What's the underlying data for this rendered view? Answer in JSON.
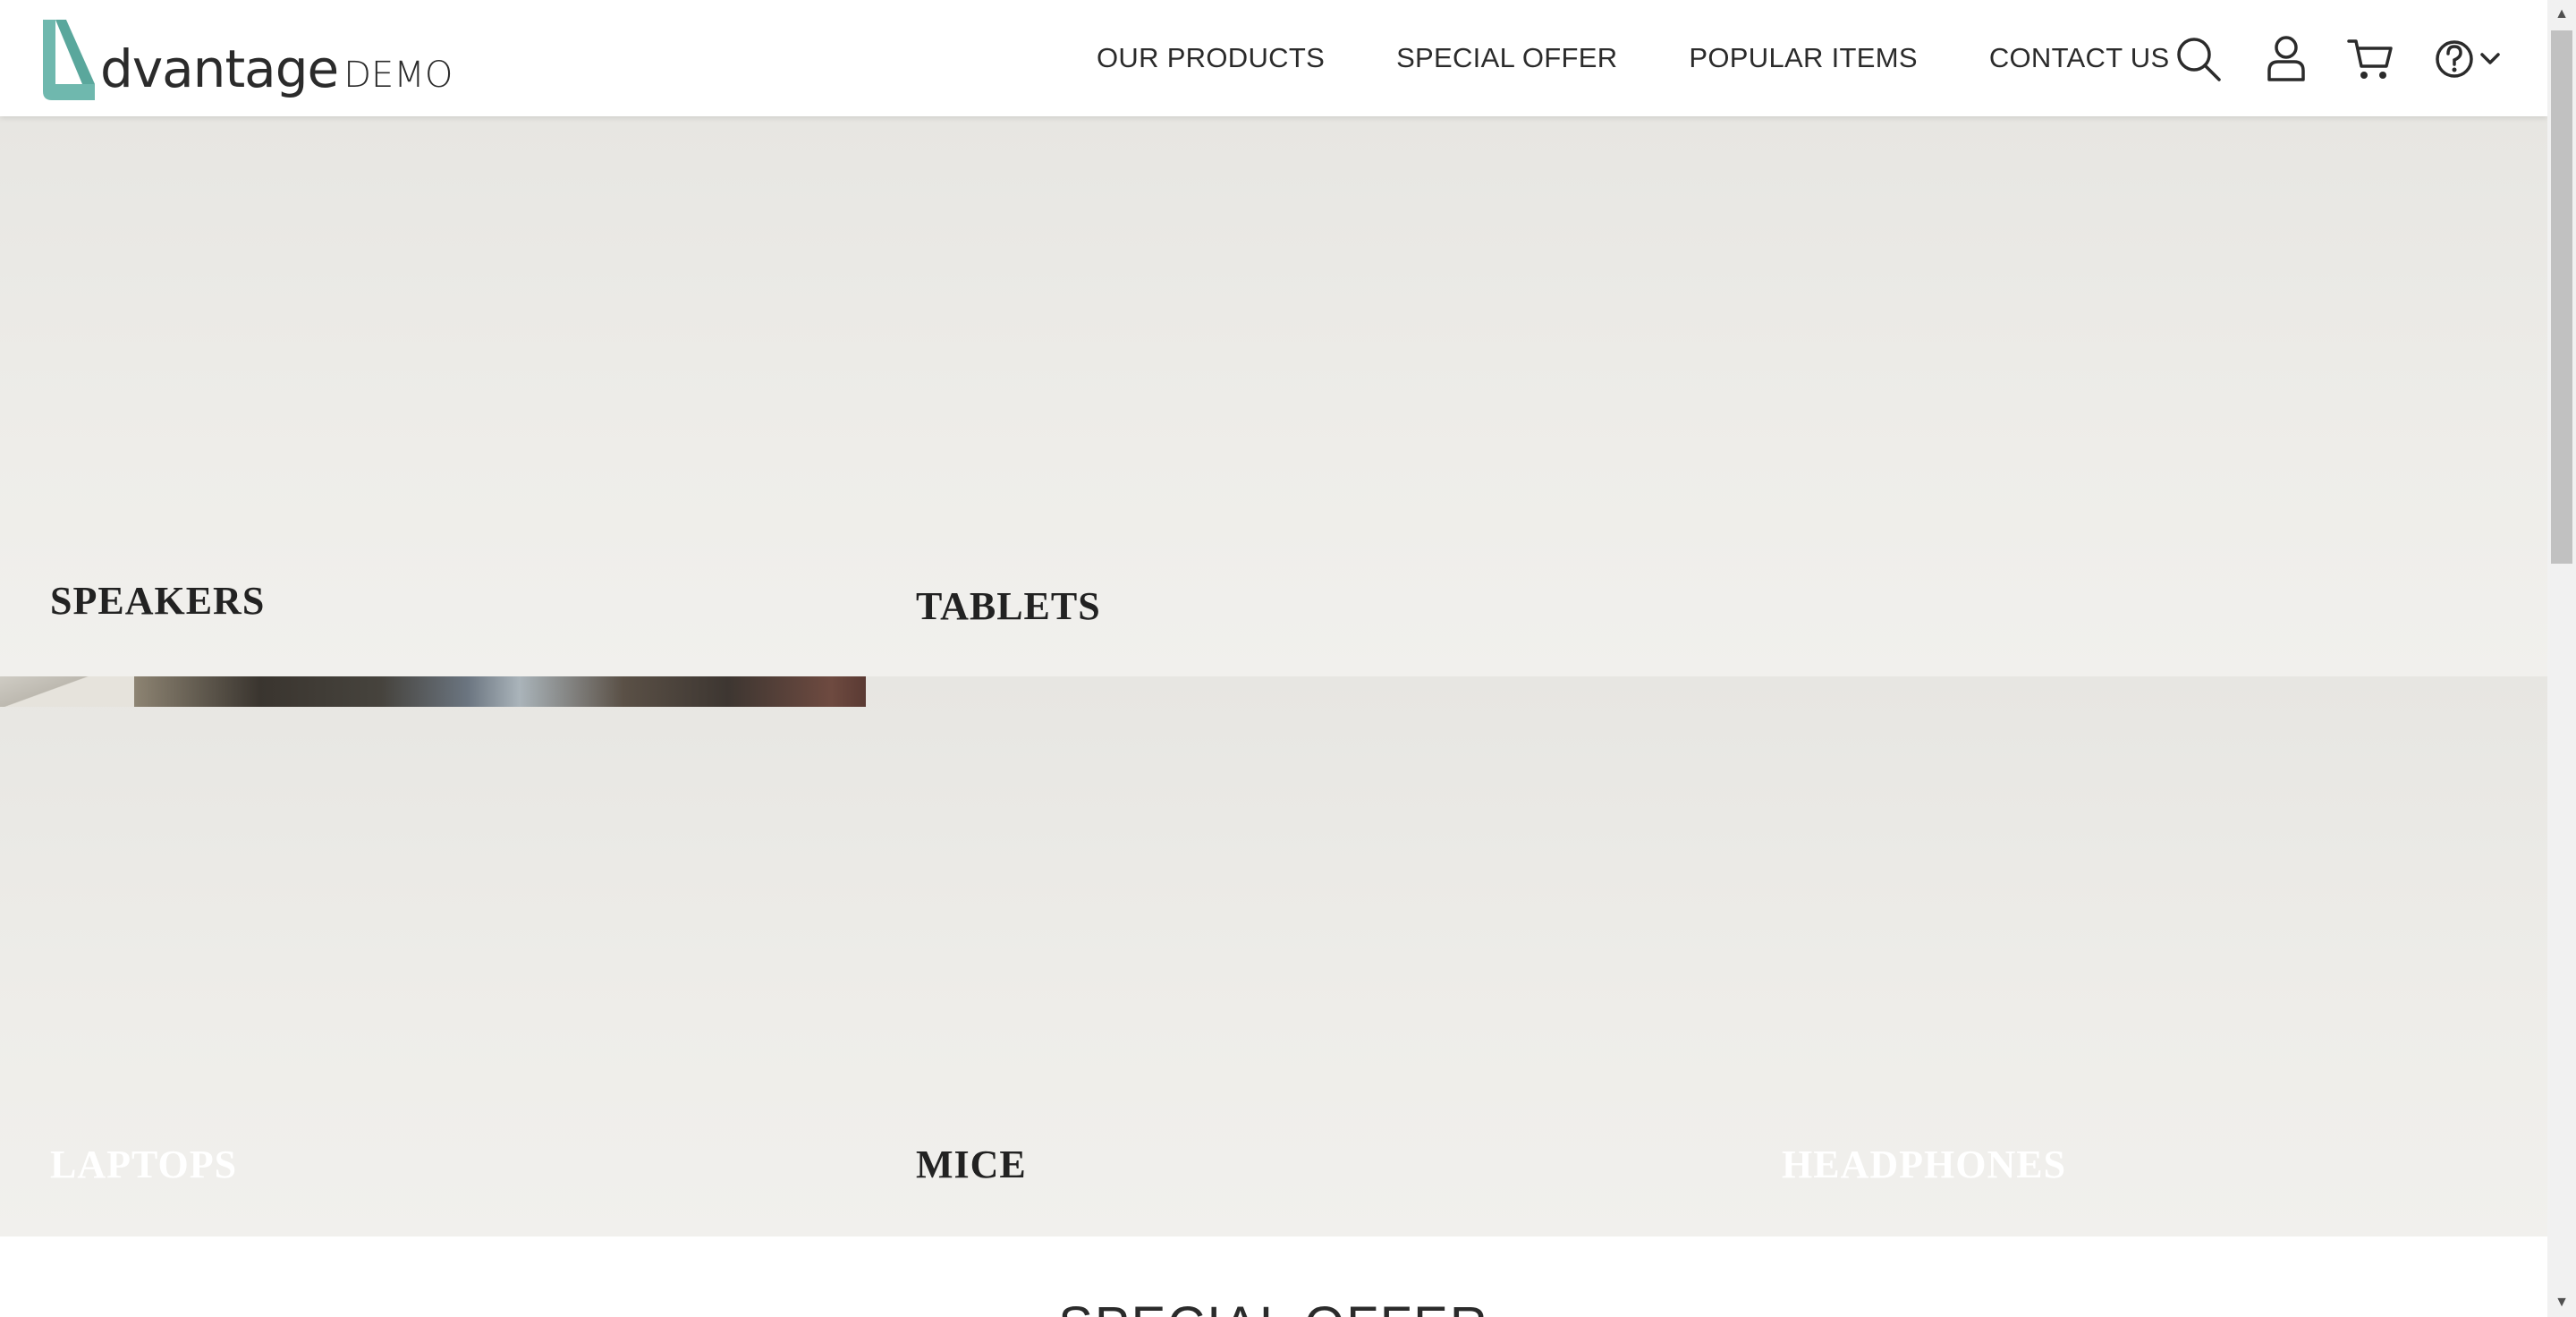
{
  "header": {
    "logo_word": "dvantage",
    "logo_suffix": "DEMO",
    "nav": [
      {
        "label": "OUR PRODUCTS"
      },
      {
        "label": "SPECIAL OFFER"
      },
      {
        "label": "POPULAR ITEMS"
      },
      {
        "label": "CONTACT US"
      }
    ],
    "icons": [
      "search-icon",
      "user-icon",
      "cart-icon",
      "help-icon",
      "chevron-down-icon"
    ],
    "brand_color": "#6fb8ae"
  },
  "categories": [
    {
      "label": "SPEAKERS",
      "label_color": "#222222"
    },
    {
      "label": "TABLETS",
      "label_color": "#222222"
    },
    {
      "label": "LAPTOPS",
      "label_color": "#ffffff"
    },
    {
      "label": "MICE",
      "label_color": "#222222"
    },
    {
      "label": "HEADPHONES",
      "label_color": "#ffffff"
    }
  ],
  "sections": {
    "special_offer_title": "SPECIAL OFFER"
  }
}
